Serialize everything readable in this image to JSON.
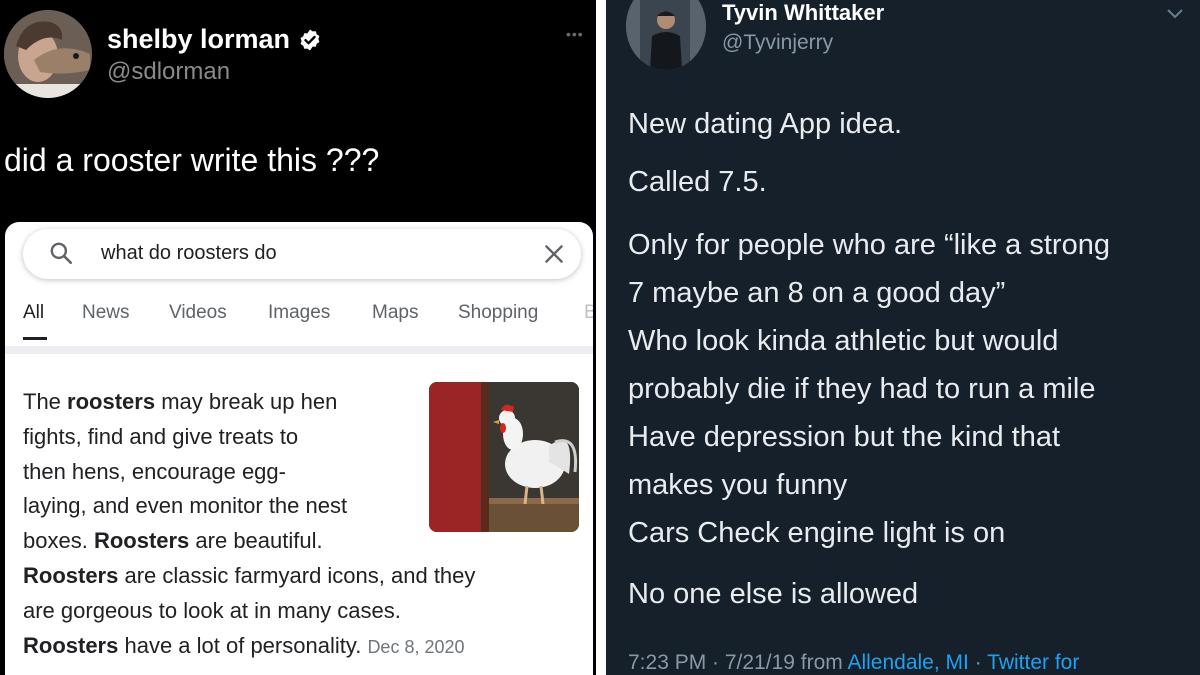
{
  "left_tweet": {
    "display_name": "shelby lorman",
    "handle": "@sdlorman",
    "more_label": "•••",
    "text": "did a rooster write this ???"
  },
  "google": {
    "search_query": "what do roosters do",
    "tabs": [
      {
        "label": "All",
        "active": true
      },
      {
        "label": "News"
      },
      {
        "label": "Videos"
      },
      {
        "label": "Images"
      },
      {
        "label": "Maps"
      },
      {
        "label": "Shopping"
      },
      {
        "label": "B"
      }
    ],
    "snippet": [
      [
        "The ",
        {
          "b": "roosters"
        },
        " may break up hen"
      ],
      [
        "fights, find and give treats to"
      ],
      [
        "then hens, encourage egg-"
      ],
      [
        "laying, and even monitor the nest"
      ],
      [
        "boxes. ",
        {
          "b": "Roosters"
        },
        " are beautiful."
      ],
      [
        {
          "b": "Roosters"
        },
        " are classic farmyard icons, and they"
      ],
      [
        "are gorgeous to look at in many cases."
      ],
      [
        {
          "b": "Roosters"
        },
        " have a lot of personality. ",
        {
          "date": "Dec 8, 2020"
        }
      ]
    ]
  },
  "right_tweet": {
    "display_name": "Tyvin Whittaker",
    "handle": "@Tyvinjerry",
    "lines": [
      "New dating App idea.",
      "Called 7.5.",
      "Only for people who are “like a strong",
      "7 maybe an 8 on a good day”",
      "Who look kinda athletic but would",
      "probably die if they had to run a mile",
      "Have depression but the kind that",
      "makes you funny",
      "Cars Check engine light is on",
      "No one else is allowed"
    ],
    "meta": {
      "time": "7:23 PM · 7/21/19 from ",
      "location": "Allendale, MI",
      "sep": " · ",
      "source": "Twitter for"
    }
  },
  "colors": {
    "left_bg": "#000000",
    "right_bg": "#15202b",
    "link": "#1da1f2",
    "verified": "#ffffff"
  }
}
